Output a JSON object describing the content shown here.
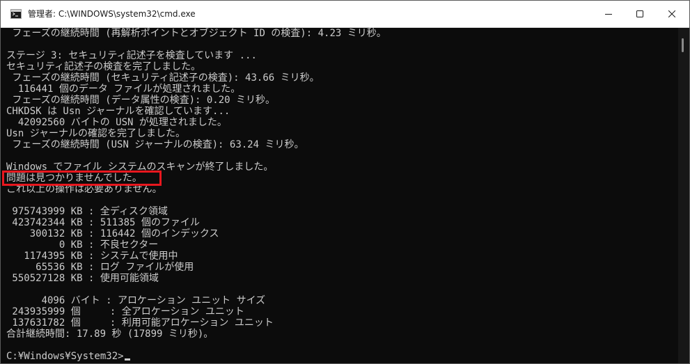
{
  "window": {
    "title": "管理者: C:\\WINDOWS\\system32\\cmd.exe",
    "icon": "cmd-icon"
  },
  "controls": {
    "minimize_icon": "minimize-icon",
    "maximize_icon": "maximize-icon",
    "close_icon": "close-icon"
  },
  "console": {
    "lines": [
      " フェーズの継続時間 (再解析ポイントとオブジェクト ID の検査): 4.23 ミリ秒。",
      "",
      "ステージ 3: セキュリティ記述子を検査しています ...",
      "セキュリティ記述子の検査を完了しました。",
      " フェーズの継続時間 (セキュリティ記述子の検査): 43.66 ミリ秒。",
      "  116441 個のデータ ファイルが処理されました。",
      " フェーズの継続時間 (データ属性の検査): 0.20 ミリ秒。",
      "CHKDSK は Usn ジャーナルを確認しています...",
      "  42092560 バイトの USN が処理されました。",
      "Usn ジャーナルの確認を完了しました。",
      " フェーズの継続時間 (USN ジャーナルの検査): 63.24 ミリ秒。",
      "",
      "Windows でファイル システムのスキャンが終了しました。",
      "問題は見つかりませんでした。",
      "これ以上の操作は必要ありません。",
      "",
      " 975743999 KB : 全ディスク領域",
      " 423742344 KB : 511385 個のファイル",
      "    300132 KB : 116442 個のインデックス",
      "         0 KB : 不良セクター",
      "   1174395 KB : システムで使用中",
      "     65536 KB : ログ ファイルが使用",
      " 550527128 KB : 使用可能領域",
      "",
      "      4096 バイト : アロケーション ユニット サイズ",
      " 243935999 個     : 全アロケーション ユニット",
      " 137631782 個     : 利用可能アロケーション ユニット",
      "合計継続時間: 17.89 秒 (17899 ミリ秒)。",
      "",
      "C:¥Windows¥System32>"
    ]
  },
  "annotation": {
    "color": "#e8171e",
    "target": "問題は見つかりませんでした。"
  },
  "colors": {
    "console_background": "#0c0c0c",
    "console_text": "#cccccc",
    "titlebar_background": "#ffffff"
  }
}
